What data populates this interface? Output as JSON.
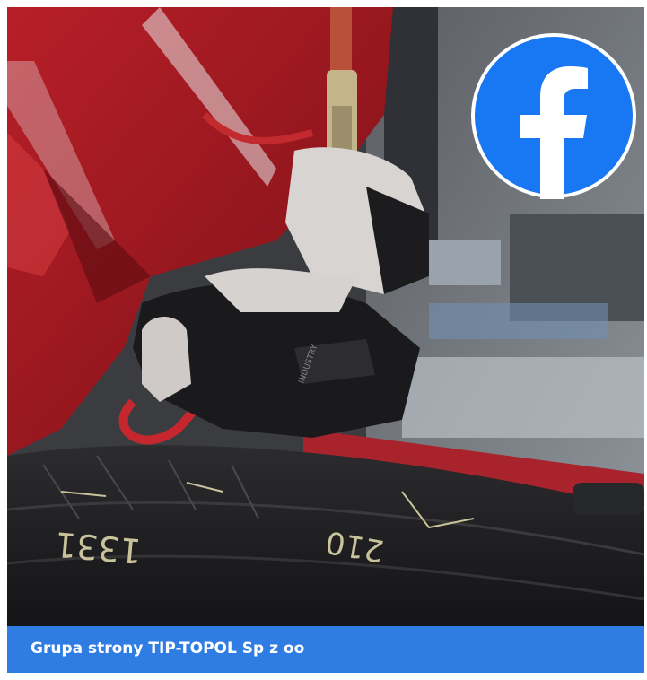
{
  "post": {
    "caption": "Grupa strony TIP-TOPOL Sp z oo",
    "tire_marking_left": "1331",
    "tire_marking_right": "210"
  },
  "badge": {
    "icon": "facebook-icon",
    "color": "#1877f2",
    "glyph": "f"
  },
  "colors": {
    "caption_bar": "#2f7de2",
    "jacket_red": "#c4242c",
    "tire": "#1e1e20"
  }
}
